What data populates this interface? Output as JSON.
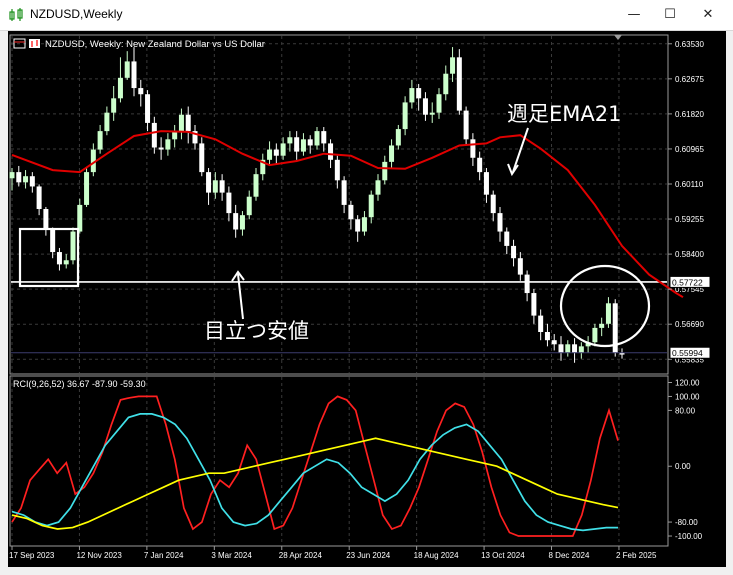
{
  "window": {
    "title": "NZDUSD,Weekly",
    "minimize_glyph": "—",
    "maximize_glyph": "☐",
    "close_glyph": "✕"
  },
  "chart_header": {
    "text": "NZDUSD, Weekly:  New Zealand Dollar vs US Dollar"
  },
  "colors": {
    "background": "#000000",
    "bull_candle": "#ccffcc",
    "bear_candle": "#ffffff",
    "ema": "#e00000",
    "grid": "#3a3a3a",
    "axis_text": "#ffffff",
    "rci_short": "#ff2020",
    "rci_mid": "#40e0e8",
    "rci_long": "#ffff00",
    "annotation": "#ffffff"
  },
  "annotations": {
    "ema_label": "週足EMA21",
    "low_label": "目立つ安値"
  },
  "chart_data": [
    {
      "type": "candlestick",
      "title": "NZDUSD, Weekly:  New Zealand Dollar vs US Dollar",
      "y_ticks": [
        "0.63530",
        "0.62675",
        "0.61820",
        "0.60965",
        "0.60110",
        "0.59255",
        "0.58400",
        "0.57545",
        "0.56690",
        "0.55835"
      ],
      "ylim": [
        0.555,
        0.6372
      ],
      "x_tick_labels": [
        "17 Sep 2023",
        "12 Nov 2023",
        "7 Jan 2024",
        "3 Mar 2024",
        "28 Apr 2024",
        "23 Jun 2024",
        "18 Aug 2024",
        "13 Oct 2024",
        "8 Dec 2024",
        "2 Feb 2025"
      ],
      "price_badges": [
        "0.57722",
        "0.55994"
      ],
      "horizontal_lines": [
        0.57722
      ],
      "series": [
        {
          "name": "EMA21",
          "points": [
            [
              0,
              0.6082
            ],
            [
              6,
              0.6045
            ],
            [
              10,
              0.604
            ],
            [
              14,
              0.6085
            ],
            [
              18,
              0.6128
            ],
            [
              22,
              0.614
            ],
            [
              26,
              0.6138
            ],
            [
              30,
              0.612
            ],
            [
              34,
              0.6085
            ],
            [
              38,
              0.6057
            ],
            [
              42,
              0.6067
            ],
            [
              46,
              0.6085
            ],
            [
              50,
              0.608
            ],
            [
              54,
              0.605
            ],
            [
              58,
              0.6048
            ],
            [
              62,
              0.6075
            ],
            [
              66,
              0.6105
            ],
            [
              70,
              0.611
            ],
            [
              72,
              0.6125
            ],
            [
              75,
              0.613
            ],
            [
              78,
              0.6097
            ],
            [
              82,
              0.6045
            ],
            [
              86,
              0.596
            ],
            [
              90,
              0.586
            ],
            [
              94,
              0.579
            ],
            [
              98,
              0.5745
            ],
            [
              99,
              0.5735
            ]
          ]
        }
      ],
      "candles": [
        [
          0.6025,
          0.604,
          0.5995,
          0.605
        ],
        [
          0.604,
          0.6015,
          0.6005,
          0.6055
        ],
        [
          0.6015,
          0.603,
          0.6,
          0.6045
        ],
        [
          0.603,
          0.6005,
          0.599,
          0.604
        ],
        [
          0.6005,
          0.595,
          0.5935,
          0.601
        ],
        [
          0.595,
          0.59,
          0.5885,
          0.5955
        ],
        [
          0.59,
          0.5845,
          0.583,
          0.5905
        ],
        [
          0.5845,
          0.5815,
          0.58,
          0.5855
        ],
        [
          0.5815,
          0.5825,
          0.5805,
          0.584
        ],
        [
          0.5825,
          0.5895,
          0.5815,
          0.5905
        ],
        [
          0.5895,
          0.596,
          0.589,
          0.5975
        ],
        [
          0.596,
          0.604,
          0.5955,
          0.605
        ],
        [
          0.604,
          0.6095,
          0.603,
          0.611
        ],
        [
          0.6095,
          0.614,
          0.6085,
          0.6155
        ],
        [
          0.614,
          0.6185,
          0.613,
          0.62
        ],
        [
          0.6185,
          0.622,
          0.6165,
          0.625
        ],
        [
          0.622,
          0.627,
          0.621,
          0.632
        ],
        [
          0.627,
          0.631,
          0.6265,
          0.6335
        ],
        [
          0.631,
          0.6245,
          0.6225,
          0.6345
        ],
        [
          0.6245,
          0.623,
          0.62,
          0.6265
        ],
        [
          0.623,
          0.616,
          0.614,
          0.624
        ],
        [
          0.616,
          0.61,
          0.6085,
          0.6175
        ],
        [
          0.61,
          0.6095,
          0.607,
          0.6125
        ],
        [
          0.6095,
          0.612,
          0.608,
          0.6135
        ],
        [
          0.612,
          0.614,
          0.61,
          0.6155
        ],
        [
          0.614,
          0.618,
          0.612,
          0.6195
        ],
        [
          0.618,
          0.614,
          0.611,
          0.62
        ],
        [
          0.614,
          0.611,
          0.6095,
          0.6155
        ],
        [
          0.611,
          0.604,
          0.603,
          0.6125
        ],
        [
          0.604,
          0.599,
          0.596,
          0.605
        ],
        [
          0.599,
          0.602,
          0.5975,
          0.604
        ],
        [
          0.602,
          0.599,
          0.597,
          0.6035
        ],
        [
          0.599,
          0.594,
          0.592,
          0.6005
        ],
        [
          0.594,
          0.59,
          0.588,
          0.596
        ],
        [
          0.59,
          0.5935,
          0.5885,
          0.5945
        ],
        [
          0.5935,
          0.598,
          0.5925,
          0.5995
        ],
        [
          0.598,
          0.6035,
          0.597,
          0.605
        ],
        [
          0.6035,
          0.607,
          0.602,
          0.6085
        ],
        [
          0.607,
          0.6095,
          0.6055,
          0.6115
        ],
        [
          0.6095,
          0.608,
          0.606,
          0.611
        ],
        [
          0.608,
          0.611,
          0.607,
          0.6125
        ],
        [
          0.611,
          0.6125,
          0.609,
          0.614
        ],
        [
          0.6125,
          0.609,
          0.607,
          0.614
        ],
        [
          0.609,
          0.612,
          0.608,
          0.6135
        ],
        [
          0.612,
          0.6105,
          0.6085,
          0.613
        ],
        [
          0.6105,
          0.614,
          0.6095,
          0.615
        ],
        [
          0.614,
          0.611,
          0.609,
          0.615
        ],
        [
          0.611,
          0.607,
          0.605,
          0.612
        ],
        [
          0.607,
          0.602,
          0.6,
          0.608
        ],
        [
          0.602,
          0.596,
          0.594,
          0.603
        ],
        [
          0.596,
          0.5925,
          0.59,
          0.597
        ],
        [
          0.5925,
          0.5895,
          0.587,
          0.5935
        ],
        [
          0.5895,
          0.593,
          0.5885,
          0.5945
        ],
        [
          0.593,
          0.5985,
          0.5915,
          0.5995
        ],
        [
          0.5985,
          0.602,
          0.597,
          0.6035
        ],
        [
          0.602,
          0.6065,
          0.601,
          0.608
        ],
        [
          0.6065,
          0.6105,
          0.605,
          0.612
        ],
        [
          0.6105,
          0.6145,
          0.6095,
          0.6155
        ],
        [
          0.6145,
          0.621,
          0.613,
          0.6225
        ],
        [
          0.621,
          0.6245,
          0.6195,
          0.6265
        ],
        [
          0.6245,
          0.622,
          0.619,
          0.6255
        ],
        [
          0.622,
          0.618,
          0.6165,
          0.6235
        ],
        [
          0.618,
          0.6185,
          0.616,
          0.621
        ],
        [
          0.6185,
          0.623,
          0.617,
          0.6245
        ],
        [
          0.623,
          0.628,
          0.6215,
          0.63
        ],
        [
          0.628,
          0.632,
          0.626,
          0.6345
        ],
        [
          0.632,
          0.619,
          0.618,
          0.634
        ],
        [
          0.619,
          0.612,
          0.6105,
          0.62
        ],
        [
          0.612,
          0.6075,
          0.6055,
          0.6135
        ],
        [
          0.6075,
          0.604,
          0.602,
          0.609
        ],
        [
          0.604,
          0.5985,
          0.5965,
          0.605
        ],
        [
          0.5985,
          0.594,
          0.592,
          0.5995
        ],
        [
          0.594,
          0.5895,
          0.587,
          0.5955
        ],
        [
          0.5895,
          0.586,
          0.584,
          0.5905
        ],
        [
          0.586,
          0.583,
          0.581,
          0.5875
        ],
        [
          0.583,
          0.579,
          0.5775,
          0.5845
        ],
        [
          0.579,
          0.5745,
          0.5725,
          0.58
        ],
        [
          0.5745,
          0.569,
          0.567,
          0.5755
        ],
        [
          0.569,
          0.565,
          0.563,
          0.5705
        ],
        [
          0.565,
          0.563,
          0.5615,
          0.567
        ],
        [
          0.563,
          0.562,
          0.5605,
          0.5645
        ],
        [
          0.562,
          0.56,
          0.558,
          0.564
        ],
        [
          0.56,
          0.562,
          0.559,
          0.563
        ],
        [
          0.562,
          0.56,
          0.5575,
          0.5635
        ],
        [
          0.56,
          0.5615,
          0.5585,
          0.5625
        ],
        [
          0.5615,
          0.5625,
          0.56,
          0.564
        ],
        [
          0.5625,
          0.566,
          0.5615,
          0.567
        ],
        [
          0.566,
          0.567,
          0.564,
          0.5685
        ],
        [
          0.567,
          0.572,
          0.566,
          0.5735
        ],
        [
          0.572,
          0.56,
          0.559,
          0.573
        ],
        [
          0.56,
          0.5595,
          0.5585,
          0.561
        ]
      ]
    },
    {
      "type": "line",
      "title": "RCI(9,26,52) 36.67 -87.90 -59.30",
      "y_ticks": [
        "120.00",
        "100.00",
        "80.00",
        "0.00",
        "-80.00",
        "-100.00"
      ],
      "ylim": [
        -110,
        125
      ],
      "series": [
        {
          "name": "RCI 9",
          "values": [
            -80,
            -60,
            -20,
            -5,
            10,
            -10,
            5,
            -40,
            -30,
            -10,
            20,
            60,
            95,
            98,
            100,
            100,
            100,
            60,
            10,
            -60,
            -90,
            -80,
            -40,
            -20,
            -30,
            -10,
            30,
            10,
            -40,
            -90,
            -85,
            -60,
            -20,
            20,
            60,
            90,
            100,
            95,
            80,
            30,
            -20,
            -70,
            -90,
            -85,
            -60,
            -30,
            10,
            50,
            80,
            90,
            85,
            60,
            20,
            -30,
            -70,
            -95,
            -100,
            -100,
            -100,
            -100,
            -100,
            -100,
            -100,
            -70,
            -20,
            40,
            80,
            36.67
          ]
        },
        {
          "name": "RCI 26",
          "values": [
            -65,
            -70,
            -80,
            -85,
            -80,
            -60,
            -30,
            0,
            30,
            50,
            70,
            75,
            75,
            70,
            60,
            40,
            10,
            -20,
            -60,
            -80,
            -85,
            -82,
            -70,
            -50,
            -30,
            -10,
            0,
            10,
            5,
            -10,
            -30,
            -40,
            -50,
            -40,
            -20,
            10,
            30,
            45,
            55,
            60,
            50,
            30,
            10,
            -20,
            -50,
            -70,
            -80,
            -85,
            -90,
            -92,
            -90,
            -88,
            -87.9
          ]
        },
        {
          "name": "RCI 52",
          "values": [
            -70,
            -75,
            -85,
            -90,
            -88,
            -80,
            -70,
            -60,
            -50,
            -40,
            -30,
            -20,
            -15,
            -10,
            -10,
            -5,
            0,
            5,
            10,
            15,
            20,
            25,
            30,
            35,
            40,
            35,
            30,
            25,
            20,
            15,
            10,
            5,
            0,
            -10,
            -20,
            -30,
            -40,
            -45,
            -50,
            -55,
            -59.3
          ]
        }
      ]
    }
  ]
}
